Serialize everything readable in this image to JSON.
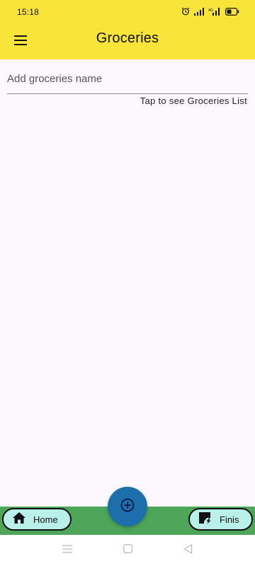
{
  "status_bar": {
    "time": "15:18",
    "icons": [
      "alarm-icon",
      "signal-icon",
      "signal-4g-icon",
      "battery-icon"
    ]
  },
  "app_bar": {
    "title": "Groceries",
    "menu_icon": "menu-icon"
  },
  "main": {
    "input_placeholder": "Add groceries name",
    "input_value": "",
    "hint_link": "Tap to see Groceries List"
  },
  "bottom_bar": {
    "home_label": "Home",
    "finish_label": "Finis",
    "fab_icon": "add-circle-icon"
  },
  "nav_bar": {
    "icons": [
      "recents-icon",
      "home-square-icon",
      "back-triangle-icon"
    ]
  },
  "colors": {
    "app_bar": "#f9e43a",
    "background": "#fdf8fd",
    "bottom_bar": "#4ea65a",
    "pill": "#b9f0ea",
    "fab": "#1c6fab"
  }
}
